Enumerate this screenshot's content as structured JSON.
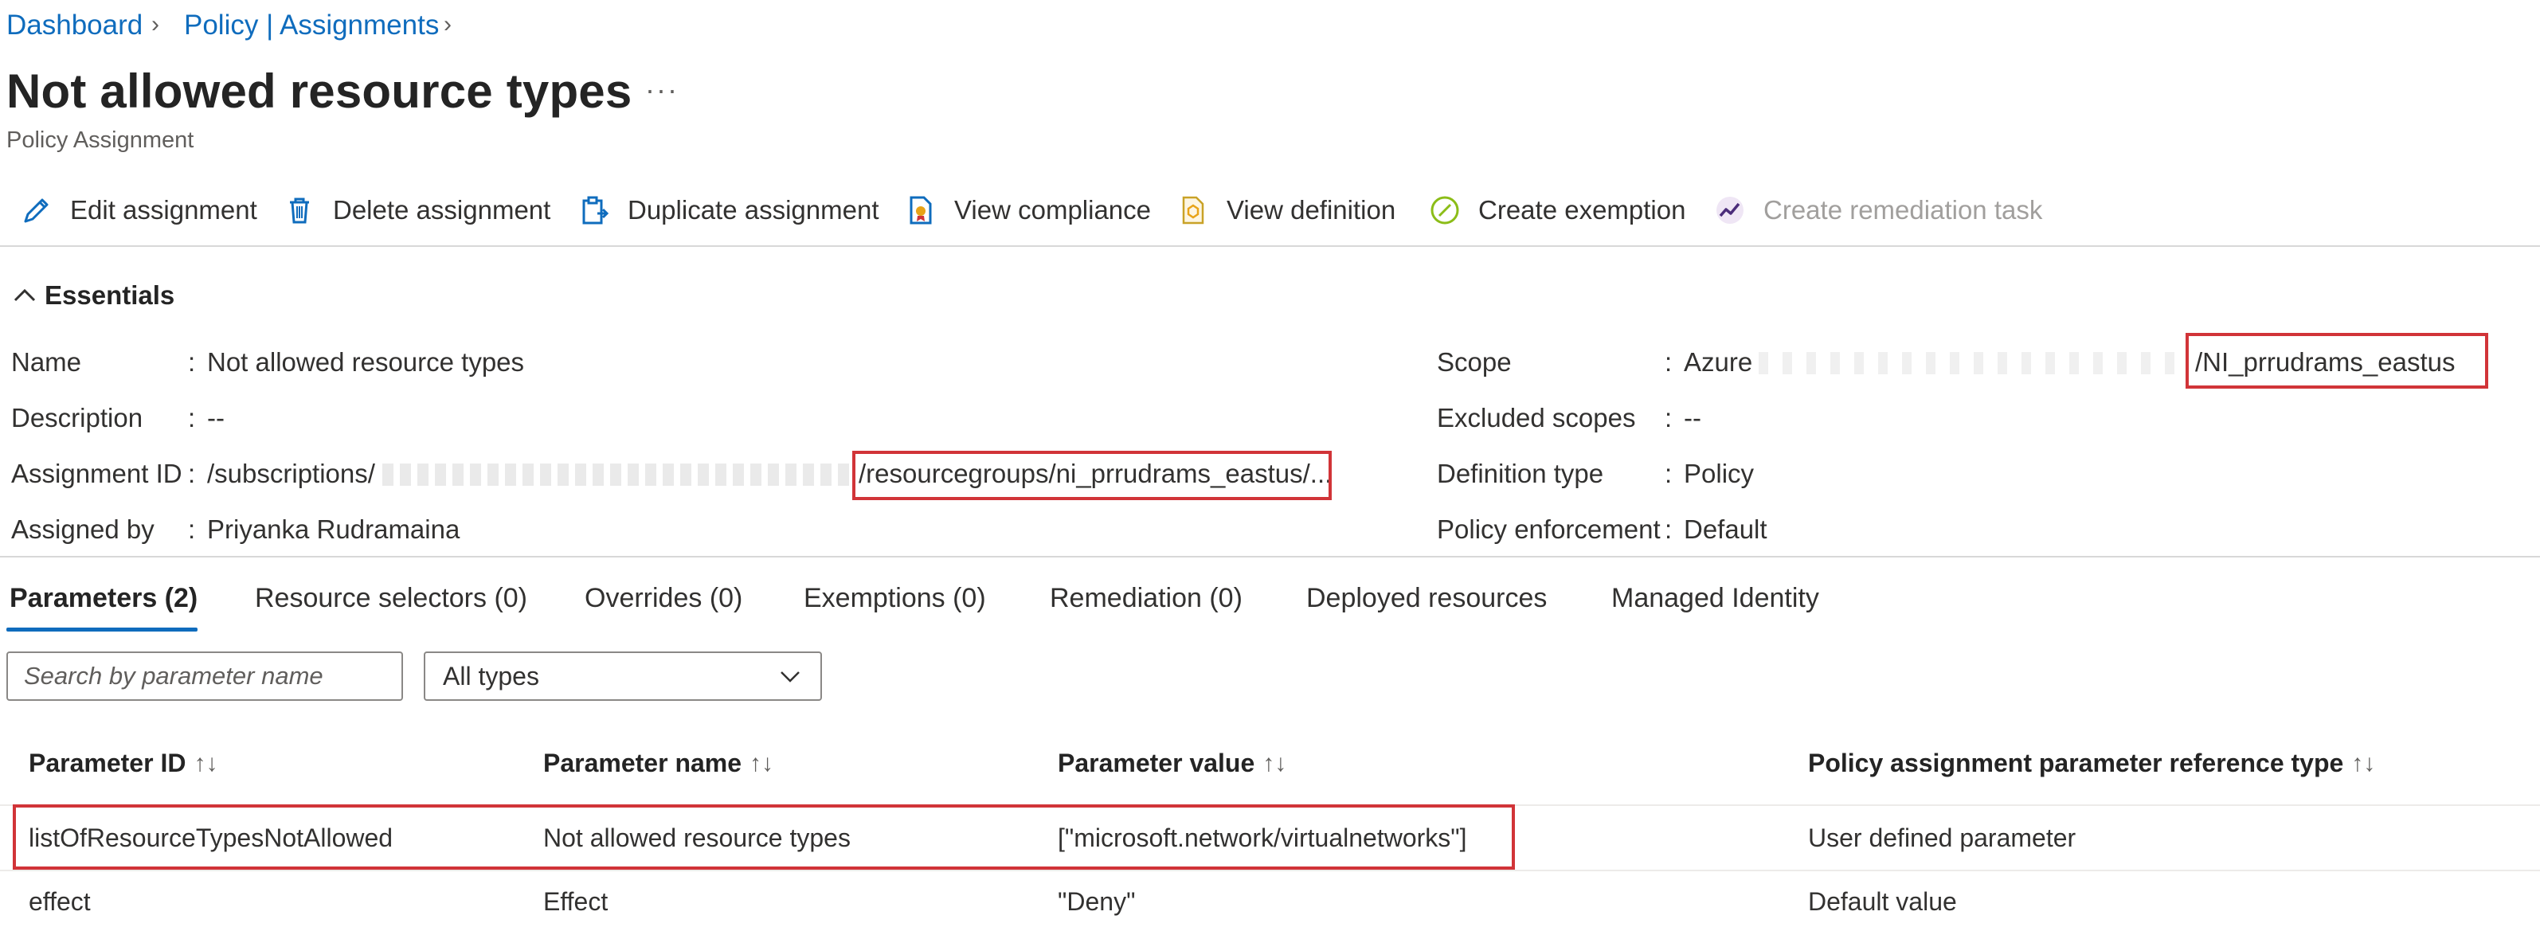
{
  "breadcrumb": {
    "items": [
      "Dashboard",
      "Policy | Assignments"
    ]
  },
  "page": {
    "title": "Not allowed resource types",
    "subtitle": "Policy Assignment",
    "more": "···"
  },
  "toolbar": {
    "edit": "Edit assignment",
    "delete": "Delete assignment",
    "duplicate": "Duplicate assignment",
    "compliance": "View compliance",
    "definition": "View definition",
    "exemption": "Create exemption",
    "remediation": "Create remediation task"
  },
  "essentials": {
    "header": "Essentials",
    "left": [
      {
        "label": "Name",
        "value": "Not allowed resource types"
      },
      {
        "label": "Description",
        "value": "--"
      },
      {
        "label": "Assignment ID",
        "value_prefix": "/subscriptions/",
        "value_highlight": "/resourcegroups/ni_prrudrams_eastus/..."
      },
      {
        "label": "Assigned by",
        "value": "Priyanka Rudramaina"
      }
    ],
    "right": [
      {
        "label": "Scope",
        "value_prefix": "Azure",
        "value_highlight": "/NI_prrudrams_eastus"
      },
      {
        "label": "Excluded scopes",
        "value": "--"
      },
      {
        "label": "Definition type",
        "value": "Policy"
      },
      {
        "label": "Policy enforcement",
        "value": "Default"
      }
    ]
  },
  "tabs": [
    {
      "label": "Parameters (2)",
      "active": true
    },
    {
      "label": "Resource selectors (0)"
    },
    {
      "label": "Overrides (0)"
    },
    {
      "label": "Exemptions (0)"
    },
    {
      "label": "Remediation (0)"
    },
    {
      "label": "Deployed resources"
    },
    {
      "label": "Managed Identity"
    }
  ],
  "filters": {
    "search_placeholder": "Search by parameter name",
    "type_selected": "All types"
  },
  "table": {
    "columns": [
      "Parameter ID",
      "Parameter name",
      "Parameter value",
      "Policy assignment parameter reference type"
    ],
    "sort_glyph": "↑↓",
    "rows": [
      [
        "listOfResourceTypesNotAllowed",
        "Not allowed resource types",
        "[\"microsoft.network/virtualnetworks\"]",
        "User defined parameter"
      ],
      [
        "effect",
        "Effect",
        "\"Deny\"",
        "Default value"
      ]
    ]
  },
  "colors": {
    "accent": "#0f6cbd",
    "highlight": "#d13438",
    "text": "#323130"
  }
}
